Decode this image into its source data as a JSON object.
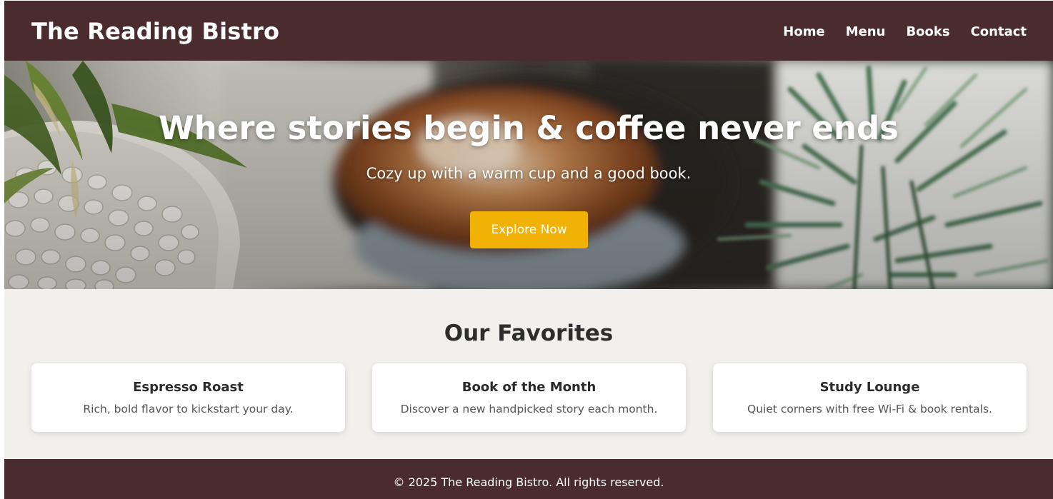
{
  "header": {
    "brand": "The Reading Bistro",
    "nav": [
      "Home",
      "Menu",
      "Books",
      "Contact"
    ]
  },
  "hero": {
    "title": "Where stories begin & coffee never ends",
    "subtitle": "Cozy up with a warm cup and a good book.",
    "cta_label": "Explore Now"
  },
  "favorites": {
    "title": "Our Favorites",
    "cards": [
      {
        "title": "Espresso Roast",
        "text": "Rich, bold flavor to kickstart your day."
      },
      {
        "title": "Book of the Month",
        "text": "Discover a new handpicked story each month."
      },
      {
        "title": "Study Lounge",
        "text": "Quiet corners with free Wi-Fi & book rentals."
      }
    ]
  },
  "footer": {
    "text": "© 2025 The Reading Bistro. All rights reserved."
  },
  "colors": {
    "header_bg": "#4a2c2f",
    "accent": "#f1b105",
    "section_bg": "#f2f0ec"
  }
}
